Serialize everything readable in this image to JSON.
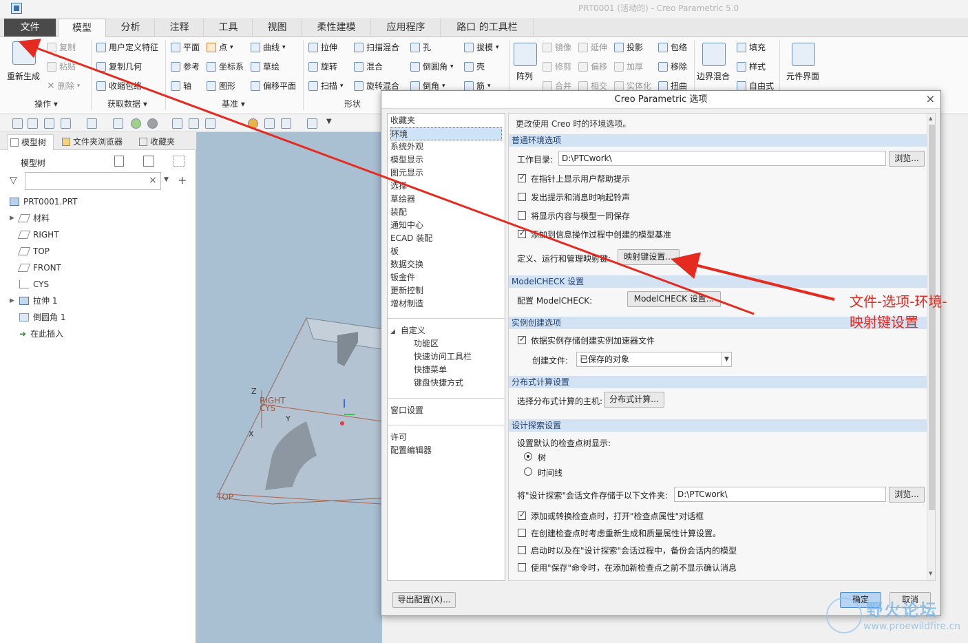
{
  "window": {
    "title": "PRT0001 (活动的) - Creo Parametric 5.0"
  },
  "tabs": [
    "文件",
    "模型",
    "分析",
    "注释",
    "工具",
    "视图",
    "柔性建模",
    "应用程序",
    "路口 的工具栏"
  ],
  "ribbon": {
    "operations": {
      "regenerate": "重新生成",
      "copy": "复制",
      "paste": "粘贴",
      "delete": "删除",
      "group": "操作"
    },
    "get_data": {
      "udf": "用户定义特征",
      "copy_geom": "复制几何",
      "shrinkwrap": "收缩包络",
      "group": "获取数据"
    },
    "datum": {
      "plane": "平面",
      "axis": "轴",
      "point": "点",
      "csys": "坐标系",
      "graph": "图形",
      "curve": "曲线",
      "sketch": "草绘",
      "offset_plane": "偏移平面",
      "ref": "参考",
      "group": "基准"
    },
    "shapes": {
      "extrude": "拉伸",
      "revolve": "旋转",
      "sweep": "扫描",
      "sweep_blend": "扫描混合",
      "blend": "混合",
      "rot_blend": "旋转混合",
      "group": "形状"
    },
    "engineering": {
      "hole": "孔",
      "round": "倒圆角",
      "chamfer": "倒角",
      "draft": "拔模",
      "shell": "壳",
      "rib": "筋"
    },
    "editing": {
      "pattern": "阵列",
      "mirror": "镜像",
      "trim": "修剪",
      "merge": "合并",
      "extend": "延伸",
      "offset": "偏移",
      "intersect": "相交",
      "project": "投影",
      "thicken": "加厚",
      "solidify": "实体化",
      "wrap": "包络",
      "remove": "移除",
      "flatten": "扭曲"
    },
    "surfaces": {
      "boundary_blend": "边界混合",
      "fill": "填充",
      "style": "样式",
      "freestyle": "自由式"
    },
    "component": {
      "interface": "元件界面"
    }
  },
  "left_panel": {
    "tabs": [
      "模型树",
      "文件夹浏览器",
      "收藏夹"
    ],
    "header": "模型树",
    "tree": [
      "PRT0001.PRT",
      "材料",
      "RIGHT",
      "TOP",
      "FRONT",
      "CYS",
      "拉伸 1",
      "倒圆角 1",
      "在此插入"
    ]
  },
  "graphics": {
    "labels": [
      "RIGHT",
      "CYS",
      "TOP",
      "Z",
      "Y",
      "X"
    ]
  },
  "dialog": {
    "title": "Creo Parametric 选项",
    "categories_top": [
      "收藏夹",
      "环境",
      "系统外观",
      "模型显示",
      "图元显示",
      "选择",
      "草绘器",
      "装配",
      "通知中心",
      "ECAD 装配",
      "板",
      "数据交换",
      "钣金件",
      "更新控制",
      "增材制造"
    ],
    "custom_header": "自定义",
    "categories_custom": [
      "功能区",
      "快速访问工具栏",
      "快捷菜单",
      "键盘快捷方式"
    ],
    "category_window": "窗口设置",
    "categories_bottom": [
      "许可",
      "配置编辑器"
    ],
    "description": "更改使用 Creo 时的环境选项。",
    "general": {
      "header": "普通环境选项",
      "workdir_label": "工作目录:",
      "workdir_value": "D:\\PTCwork\\",
      "browse": "浏览...",
      "opt1": "在指针上显示用户帮助提示",
      "opt2": "发出提示和消息时响起铃声",
      "opt3": "将显示内容与模型一同保存",
      "opt4": "添加到信息操作过程中创建的模型基准",
      "mapkey_label": "定义、运行和管理映射键:",
      "mapkey_button": "映射键设置..."
    },
    "modelcheck": {
      "header": "ModelCHECK 设置",
      "label": "配置 ModelCHECK:",
      "button": "ModelCHECK 设置..."
    },
    "instance": {
      "header": "实例创建选项",
      "opt": "依据实例存储创建实例加速器文件",
      "create_label": "创建文件:",
      "create_value": "已保存的对象"
    },
    "distributed": {
      "header": "分布式计算设置",
      "label": "选择分布式计算的主机:",
      "button": "分布式计算..."
    },
    "design_explore": {
      "header": "设计探索设置",
      "tree_display_label": "设置默认的检查点树显示:",
      "radio_tree": "树",
      "radio_timeline": "时间线",
      "store_label": "将\"设计探索\"会话文件存储于以下文件夹:",
      "store_value": "D:\\PTCwork\\",
      "browse": "浏览...",
      "opt1": "添加或转换检查点时，打开\"检查点属性\"对话框",
      "opt2": "在创建检查点时考虑重新生成和质量属性计算设置。",
      "opt3": "启动时以及在\"设计探索\"会话过程中，备份会话内的模型",
      "opt4": "使用\"保存\"命令时，在添加新检查点之前不显示确认消息"
    },
    "export_button": "导出配置(X)...",
    "ok_button": "确定",
    "cancel_button": "取消"
  },
  "annotation": {
    "line1": "文件-选项-环境-",
    "line2": "映射键设置",
    "color": "#e52b20"
  },
  "watermark": {
    "title": "野火论坛",
    "url": "www.proewildfire.cn"
  }
}
